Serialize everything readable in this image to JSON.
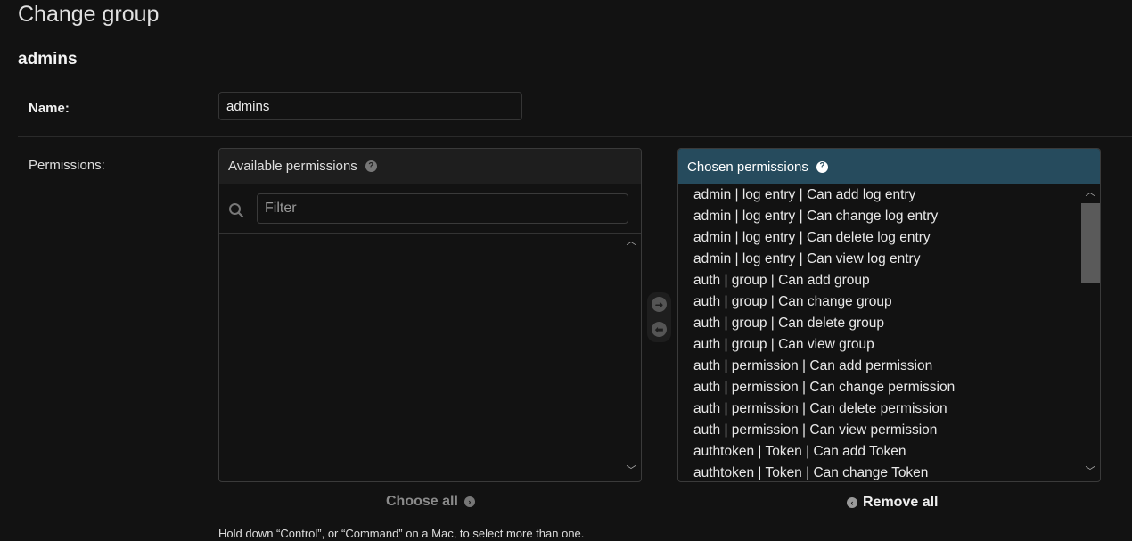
{
  "page": {
    "title": "Change group",
    "fieldset_title": "admins"
  },
  "name_field": {
    "label": "Name:",
    "value": "admins"
  },
  "permissions": {
    "label": "Permissions:",
    "available": {
      "title": "Available permissions",
      "filter_placeholder": "Filter",
      "items": []
    },
    "chosen": {
      "title": "Chosen permissions",
      "items": [
        "admin | log entry | Can add log entry",
        "admin | log entry | Can change log entry",
        "admin | log entry | Can delete log entry",
        "admin | log entry | Can view log entry",
        "auth | group | Can add group",
        "auth | group | Can change group",
        "auth | group | Can delete group",
        "auth | group | Can view group",
        "auth | permission | Can add permission",
        "auth | permission | Can change permission",
        "auth | permission | Can delete permission",
        "auth | permission | Can view permission",
        "authtoken | Token | Can add Token",
        "authtoken | Token | Can change Token"
      ]
    },
    "choose_all_label": "Choose all",
    "remove_all_label": "Remove all",
    "help_text": "Hold down “Control”, or “Command” on a Mac, to select more than one."
  },
  "icons": {
    "help": "question-circle-icon",
    "search": "search-icon",
    "add": "arrow-right-circle-icon",
    "remove": "arrow-left-circle-icon"
  },
  "colors": {
    "background": "#121212",
    "chosen_header": "#264b5d"
  }
}
